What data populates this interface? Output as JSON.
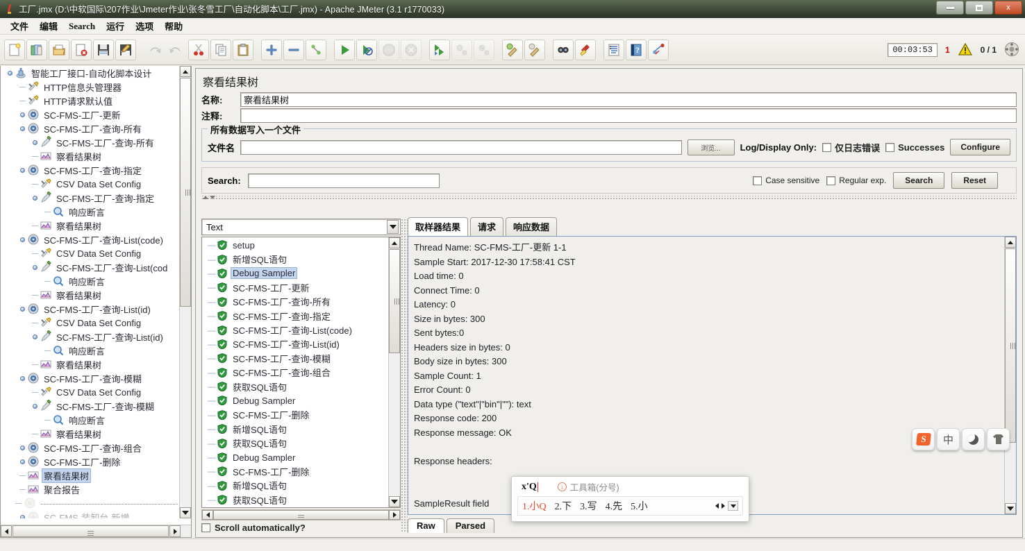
{
  "window": {
    "title": "工厂.jmx (D:\\中软国际\\207作业\\Jmeter作业\\张冬雪工厂\\自动化脚本\\工厂.jmx) - Apache JMeter (3.1 r1770033)",
    "minimize_label": "",
    "maximize_label": "",
    "close_label": "x"
  },
  "menubar": {
    "items": [
      {
        "label": "文件"
      },
      {
        "label": "编辑"
      },
      {
        "label": "Search"
      },
      {
        "label": "运行"
      },
      {
        "label": "选项"
      },
      {
        "label": "帮助"
      }
    ]
  },
  "toolbar": {
    "icons": [
      "new-icon",
      "templates-icon",
      "open-icon",
      "close-icon",
      "save-icon",
      "save-as-icon",
      "undo-icon",
      "redo-icon",
      "cut-icon",
      "copy-icon",
      "paste-icon",
      "expand-icon",
      "collapse-icon",
      "toggle-icon",
      "start-icon",
      "start-no-timers-icon",
      "stop-icon",
      "shutdown-icon",
      "start-remote-icon",
      "stop-remote-icon",
      "shutdown-remote-icon",
      "clear-icon",
      "clear-all-icon",
      "search-icon",
      "search-reset-icon",
      "function-helper-icon",
      "help-icon",
      "thread-icon"
    ],
    "status": {
      "timer": "00:03:53",
      "error_count": "1",
      "warning_icon": "warning-triangle-icon",
      "thread_ratio": "0 / 1",
      "connector_icon": "remote-connector-icon"
    }
  },
  "tree": {
    "nodes": [
      {
        "label": "智能工厂接口-自动化脚本设计",
        "depth": 0,
        "icon": "test-plan-icon",
        "handle": "expanded",
        "selected": false
      },
      {
        "label": "HTTP信息头管理器",
        "depth": 1,
        "icon": "config-icon",
        "handle": "none",
        "selected": false
      },
      {
        "label": "HTTP请求默认值",
        "depth": 1,
        "icon": "config-icon",
        "handle": "none",
        "selected": false
      },
      {
        "label": "SC-FMS-工厂-更新",
        "depth": 1,
        "icon": "thread-group-icon",
        "handle": "collapsed",
        "selected": false
      },
      {
        "label": "SC-FMS-工厂-查询-所有",
        "depth": 1,
        "icon": "thread-group-icon",
        "handle": "expanded",
        "selected": false
      },
      {
        "label": "SC-FMS-工厂-查询-所有",
        "depth": 2,
        "icon": "sampler-icon",
        "handle": "collapsed",
        "selected": false
      },
      {
        "label": "察看结果树",
        "depth": 2,
        "icon": "listener-icon",
        "handle": "none",
        "selected": false
      },
      {
        "label": "SC-FMS-工厂-查询-指定",
        "depth": 1,
        "icon": "thread-group-icon",
        "handle": "expanded",
        "selected": false
      },
      {
        "label": "CSV Data Set Config",
        "depth": 2,
        "icon": "config-icon",
        "handle": "none",
        "selected": false
      },
      {
        "label": "SC-FMS-工厂-查询-指定",
        "depth": 2,
        "icon": "sampler-icon",
        "handle": "expanded",
        "selected": false
      },
      {
        "label": "响应断言",
        "depth": 3,
        "icon": "assertion-icon",
        "handle": "none",
        "selected": false
      },
      {
        "label": "察看结果树",
        "depth": 2,
        "icon": "listener-icon",
        "handle": "none",
        "selected": false
      },
      {
        "label": "SC-FMS-工厂-查询-List(code)",
        "depth": 1,
        "icon": "thread-group-icon",
        "handle": "expanded",
        "selected": false
      },
      {
        "label": "CSV Data Set Config",
        "depth": 2,
        "icon": "config-icon",
        "handle": "none",
        "selected": false
      },
      {
        "label": "SC-FMS-工厂-查询-List(cod",
        "depth": 2,
        "icon": "sampler-icon",
        "handle": "expanded",
        "selected": false
      },
      {
        "label": "响应断言",
        "depth": 3,
        "icon": "assertion-icon",
        "handle": "none",
        "selected": false
      },
      {
        "label": "察看结果树",
        "depth": 2,
        "icon": "listener-icon",
        "handle": "none",
        "selected": false
      },
      {
        "label": "SC-FMS-工厂-查询-List(id)",
        "depth": 1,
        "icon": "thread-group-icon",
        "handle": "expanded",
        "selected": false
      },
      {
        "label": "CSV Data Set Config",
        "depth": 2,
        "icon": "config-icon",
        "handle": "none",
        "selected": false
      },
      {
        "label": "SC-FMS-工厂-查询-List(id)",
        "depth": 2,
        "icon": "sampler-icon",
        "handle": "expanded",
        "selected": false
      },
      {
        "label": "响应断言",
        "depth": 3,
        "icon": "assertion-icon",
        "handle": "none",
        "selected": false
      },
      {
        "label": "察看结果树",
        "depth": 2,
        "icon": "listener-icon",
        "handle": "none",
        "selected": false
      },
      {
        "label": "SC-FMS-工厂-查询-模糊",
        "depth": 1,
        "icon": "thread-group-icon",
        "handle": "expanded",
        "selected": false
      },
      {
        "label": "CSV Data Set Config",
        "depth": 2,
        "icon": "config-icon",
        "handle": "none",
        "selected": false
      },
      {
        "label": "SC-FMS-工厂-查询-模糊",
        "depth": 2,
        "icon": "sampler-icon",
        "handle": "expanded",
        "selected": false
      },
      {
        "label": "响应断言",
        "depth": 3,
        "icon": "assertion-icon",
        "handle": "none",
        "selected": false
      },
      {
        "label": "察看结果树",
        "depth": 2,
        "icon": "listener-icon",
        "handle": "none",
        "selected": false
      },
      {
        "label": "SC-FMS-工厂-查询-组合",
        "depth": 1,
        "icon": "thread-group-icon",
        "handle": "collapsed",
        "selected": false
      },
      {
        "label": "SC-FMS-工厂-删除",
        "depth": 1,
        "icon": "thread-group-icon",
        "handle": "collapsed",
        "selected": false
      },
      {
        "label": "察看结果树",
        "depth": 1,
        "icon": "listener-icon",
        "handle": "none",
        "selected": true
      },
      {
        "label": "聚合报告",
        "depth": 1,
        "icon": "listener-icon",
        "handle": "none",
        "selected": false
      },
      {
        "label": "----------------------------------------------",
        "depth": 1,
        "icon": "disabled-icon",
        "handle": "none",
        "selected": false,
        "dim": true
      },
      {
        "label": "SC-FMS-装卸台-新增",
        "depth": 1,
        "icon": "disabled-icon",
        "handle": "collapsed",
        "selected": false,
        "dim": true
      }
    ]
  },
  "main": {
    "panel_title": "察看结果树",
    "name_label": "名称:",
    "name_value": "察看结果树",
    "comment_label": "注释:",
    "comment_value": "",
    "file_group_title": "所有数据写入一个文件",
    "filename_label": "文件名",
    "filename_value": "",
    "browse_label": "浏览...",
    "log_display_only_label": "Log/Display Only:",
    "errors_only_label": "仅日志错误",
    "successes_label": "Successes",
    "configure_label": "Configure",
    "search_label": "Search:",
    "search_value": "",
    "case_sensitive_label": "Case sensitive",
    "regular_exp_label": "Regular exp.",
    "search_button_label": "Search",
    "reset_button_label": "Reset",
    "render_combo_value": "Text",
    "scroll_automatically_label": "Scroll automatically?"
  },
  "results": {
    "items": [
      {
        "label": "setup",
        "status": "success",
        "selected": false
      },
      {
        "label": "新增SQL语句",
        "status": "success",
        "selected": false
      },
      {
        "label": "Debug Sampler",
        "status": "success",
        "selected": true
      },
      {
        "label": "SC-FMS-工厂-更新",
        "status": "success",
        "selected": false
      },
      {
        "label": "SC-FMS-工厂-查询-所有",
        "status": "success",
        "selected": false
      },
      {
        "label": "SC-FMS-工厂-查询-指定",
        "status": "success",
        "selected": false
      },
      {
        "label": "SC-FMS-工厂-查询-List(code)",
        "status": "success",
        "selected": false
      },
      {
        "label": "SC-FMS-工厂-查询-List(id)",
        "status": "success",
        "selected": false
      },
      {
        "label": "SC-FMS-工厂-查询-模糊",
        "status": "success",
        "selected": false
      },
      {
        "label": "SC-FMS-工厂-查询-组合",
        "status": "success",
        "selected": false
      },
      {
        "label": "获取SQL语句",
        "status": "success",
        "selected": false
      },
      {
        "label": "Debug Sampler",
        "status": "success",
        "selected": false
      },
      {
        "label": "SC-FMS-工厂-删除",
        "status": "success",
        "selected": false
      },
      {
        "label": "新增SQL语句",
        "status": "success",
        "selected": false
      },
      {
        "label": "获取SQL语句",
        "status": "success",
        "selected": false
      },
      {
        "label": "Debug Sampler",
        "status": "success",
        "selected": false
      },
      {
        "label": "SC-FMS-工厂-删除",
        "status": "success",
        "selected": false
      },
      {
        "label": "新增SQL语句",
        "status": "success",
        "selected": false
      },
      {
        "label": "获取SQL语句",
        "status": "success",
        "selected": false
      }
    ]
  },
  "detail": {
    "tabs": [
      {
        "label": "取样器结果",
        "active": true
      },
      {
        "label": "请求",
        "active": false
      },
      {
        "label": "响应数据",
        "active": false
      }
    ],
    "body": "Thread Name: SC-FMS-工厂-更新 1-1\nSample Start: 2017-12-30 17:58:41 CST\nLoad time: 0\nConnect Time: 0\nLatency: 0\nSize in bytes: 300\nSent bytes:0\nHeaders size in bytes: 0\nBody size in bytes: 300\nSample Count: 1\nError Count: 0\nData type (\"text\"|\"bin\"|\"\"): text\nResponse code: 200\nResponse message: OK\n\nResponse headers:\n\n\nSampleResult field\nContentType:",
    "raw_tab": "Raw",
    "parsed_tab": "Parsed"
  },
  "ime": {
    "typed": "x'Q",
    "hint": "工具箱(分号)",
    "candidates": [
      "1.小Q",
      "2.下",
      "3.写",
      "4.先",
      "5.小"
    ],
    "toolbar_keys": [
      "sogou-logo-icon",
      "中",
      "moon-icon",
      "skin-icon"
    ]
  },
  "colors": {
    "accent": "#c3d5ef",
    "error": "#cc0000",
    "success": "#3a9a3a",
    "sogou_orange": "#f4622b"
  }
}
